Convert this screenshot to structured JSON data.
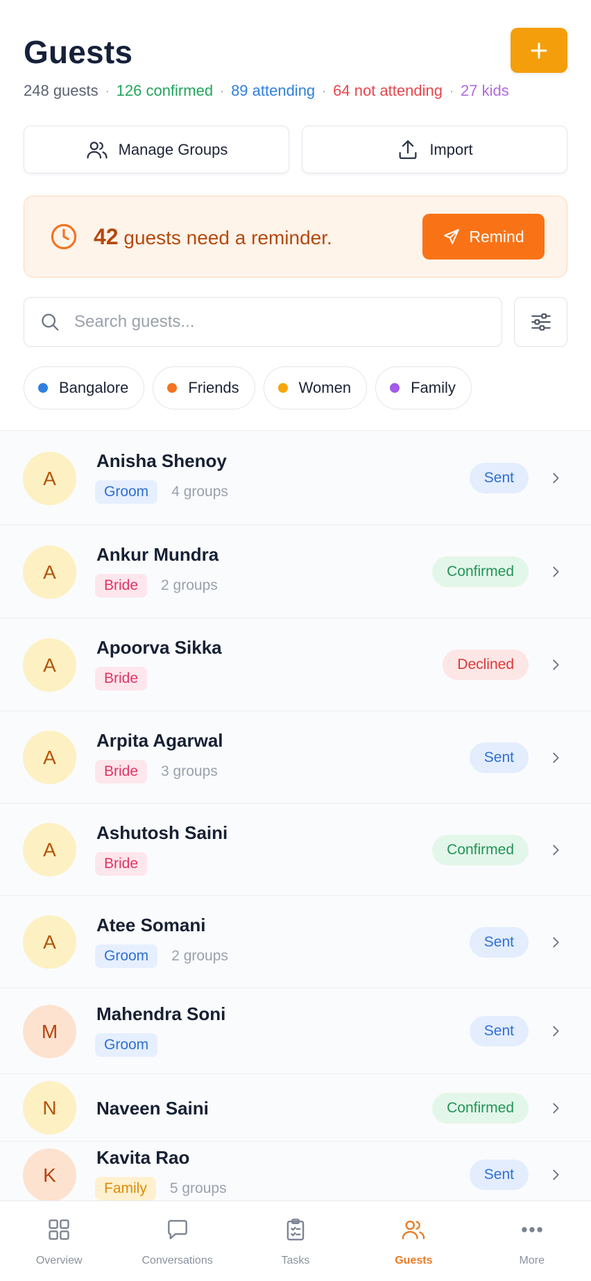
{
  "header": {
    "title": "Guests",
    "stats": [
      {
        "text": "248 guests",
        "color": "#5b6270"
      },
      {
        "text": "126 confirmed",
        "color": "#22a55b"
      },
      {
        "text": "89 attending",
        "color": "#2f7fdf"
      },
      {
        "text": "64 not attending",
        "color": "#e5484d"
      },
      {
        "text": "27 kids",
        "color": "#b06ae0"
      }
    ],
    "separator": "·"
  },
  "actions": {
    "manage_groups": "Manage Groups",
    "import": "Import"
  },
  "reminder": {
    "count": "42",
    "text": " guests need a reminder.",
    "button": "Remind"
  },
  "search": {
    "placeholder": "Search guests..."
  },
  "chips": [
    {
      "label": "Bangalore",
      "color": "#2f7fdf"
    },
    {
      "label": "Friends",
      "color": "#f47320"
    },
    {
      "label": "Women",
      "color": "#f5a60b"
    },
    {
      "label": "Family",
      "color": "#a35be8"
    }
  ],
  "guests": [
    {
      "initial": "A",
      "name": "Anisha Shenoy",
      "tag": "Groom",
      "groups": "4 groups",
      "status": "Sent"
    },
    {
      "initial": "A",
      "name": "Ankur Mundra",
      "tag": "Bride",
      "groups": "2 groups",
      "status": "Confirmed"
    },
    {
      "initial": "A",
      "name": "Apoorva Sikka",
      "tag": "Bride",
      "groups": "",
      "status": "Declined"
    },
    {
      "initial": "A",
      "name": "Arpita Agarwal",
      "tag": "Bride",
      "groups": "3 groups",
      "status": "Sent"
    },
    {
      "initial": "A",
      "name": "Ashutosh Saini",
      "tag": "Bride",
      "groups": "",
      "status": "Confirmed"
    },
    {
      "initial": "A",
      "name": "Atee Somani",
      "tag": "Groom",
      "groups": "2 groups",
      "status": "Sent"
    },
    {
      "initial": "M",
      "name": "Mahendra Soni",
      "tag": "Groom",
      "groups": "",
      "status": "Sent"
    },
    {
      "initial": "N",
      "name": "Naveen Saini",
      "tag": "",
      "groups": "",
      "status": "Confirmed"
    },
    {
      "initial": "K",
      "name": "Kavita Rao",
      "tag": "Family",
      "groups": "5 groups",
      "status": "Sent"
    }
  ],
  "tabs": [
    {
      "label": "Overview",
      "icon": "grid-icon",
      "active": false
    },
    {
      "label": "Conversations",
      "icon": "chat-bubble-icon",
      "active": false
    },
    {
      "label": "Tasks",
      "icon": "clipboard-icon",
      "active": false
    },
    {
      "label": "Guests",
      "icon": "users-icon",
      "active": true
    },
    {
      "label": "More",
      "icon": "more-dots-icon",
      "active": false
    }
  ],
  "colors": {
    "accent": "#f59e0b",
    "remind": "#f97316",
    "active_tab": "#ea7a23"
  }
}
